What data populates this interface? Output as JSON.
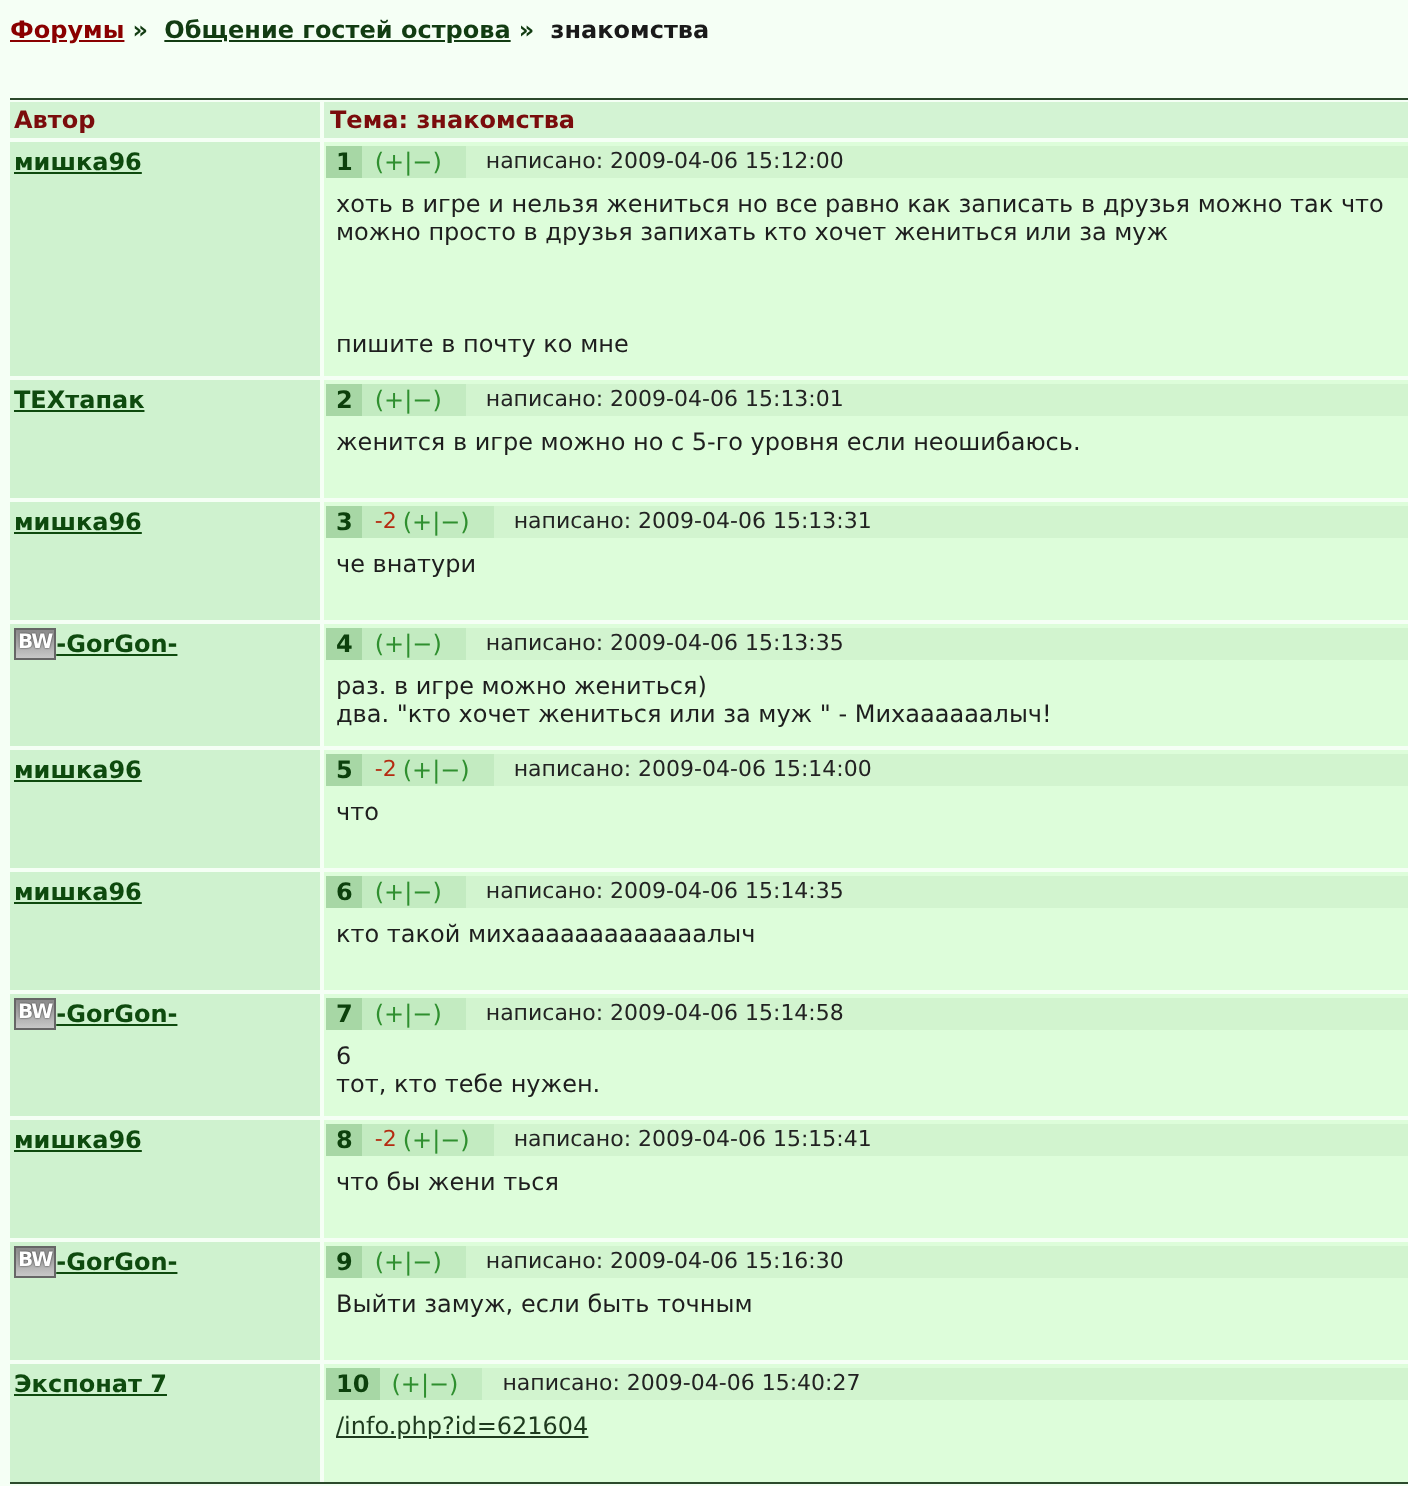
{
  "breadcrumb": [
    {
      "label": "Форумы",
      "kind": "root"
    },
    {
      "separator": "»",
      "label": "Общение гостей острова",
      "kind": "link"
    },
    {
      "separator": "»",
      "label": "знакомства",
      "kind": "current"
    }
  ],
  "table": {
    "columns": [
      "Автор",
      "Тема: знакомства"
    ],
    "posts": [
      {
        "kind": "text",
        "author": "мишка96",
        "number": "1",
        "rating": "(+|−)",
        "posted": "написано: 2009-04-06 15:12:00",
        "body": "хоть в игре и нельзя жениться но все равно как записать в друзья можно так что можно просто в друзья запихать кто хочет жениться или за муж\n\n\n\nпишите в почту ко мне"
      },
      {
        "kind": "text",
        "author": "ТЕХтапак",
        "number": "2",
        "rating": "(+|−)",
        "posted": "написано: 2009-04-06 15:13:01",
        "body": "женится в игре можно но с 5-го уровня если неошибаюсь."
      },
      {
        "kind": "text",
        "author": "мишка96",
        "number": "3",
        "score": "-2",
        "rating": "(+|−)",
        "posted": "написано: 2009-04-06 15:13:31",
        "body": "че внатури"
      },
      {
        "kind": "text",
        "author": "-GorGon-",
        "badge": "BW",
        "number": "4",
        "rating": "(+|−)",
        "posted": "написано: 2009-04-06 15:13:35",
        "body": "раз. в игре можно жениться)\nдва. \"кто хочет жениться или за муж \" - Михаааааалыч!"
      },
      {
        "kind": "text",
        "author": "мишка96",
        "number": "5",
        "score": "-2",
        "rating": "(+|−)",
        "posted": "написано: 2009-04-06 15:14:00",
        "body": "что"
      },
      {
        "kind": "text",
        "author": "мишка96",
        "number": "6",
        "rating": "(+|−)",
        "posted": "написано: 2009-04-06 15:14:35",
        "body": "кто такой михааааааааааааалыч"
      },
      {
        "kind": "text",
        "author": "-GorGon-",
        "badge": "BW",
        "number": "7",
        "rating": "(+|−)",
        "posted": "написано: 2009-04-06 15:14:58",
        "body": "6\nтот, кто тебе нужен."
      },
      {
        "kind": "text",
        "author": "мишка96",
        "number": "8",
        "score": "-2",
        "rating": "(+|−)",
        "posted": "написано: 2009-04-06 15:15:41",
        "body": "что бы жени ться"
      },
      {
        "kind": "text",
        "author": "-GorGon-",
        "badge": "BW",
        "number": "9",
        "rating": "(+|−)",
        "posted": "написано: 2009-04-06 15:16:30",
        "body": "Выйти замуж, если быть точным"
      },
      {
        "kind": "link",
        "author": "Экспонат 7",
        "number": "10",
        "rating": "(+|−)",
        "posted": "написано: 2009-04-06 15:40:27",
        "body": "/info.php?id=621604"
      }
    ]
  }
}
